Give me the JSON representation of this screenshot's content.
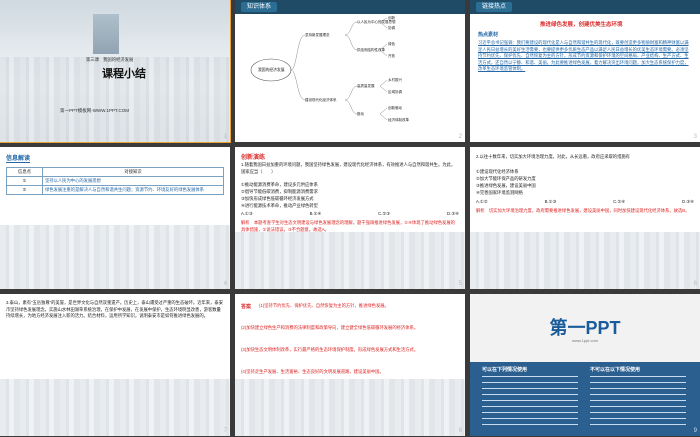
{
  "s1": {
    "section": "第三课　我国的经济发展",
    "title": "课程小结",
    "footer": "第一PPT模板网-WWW.1PPT.COM",
    "num": "1"
  },
  "s2": {
    "tag": "知识体系",
    "root": "我国的经济发展",
    "nodes": [
      "坚持新发展理念",
      "以人民为中心的发展思想",
      "创新",
      "协调",
      "绿色",
      "开放",
      "共享",
      "建设现代化经济体系",
      "供给侧结构性改革",
      "高质量发展",
      "推动",
      "坚持",
      "乡村振兴",
      "区域协调",
      "创新驱动",
      "经济体制改革",
      "对外开放"
    ],
    "num": "2"
  },
  "s3": {
    "tag": "链接热点",
    "headline": "推进绿色发展，创建优美生态环境",
    "sub": "热点素材",
    "body": "习近平总书记强调：我们要建设的现代化是人与自然和谐共生的现代化，既要创造更多物质财富和精神财富以满足人民日益增长的美好生活需要，也要提供更多优质生态产品以满足人民日益增长的优美生态环境需要。必须坚持节约优先、保护优先、自然恢复为主的方针，形成节约资源和保护环境的空间格局、产业结构、生产方式、生活方式，还自然以宁静、和谐、美丽。为此要推进绿色发展，着力解决突出环境问题，加大生态系统保护力度，改革生态环境监管体制。",
    "num": "3"
  },
  "s4": {
    "tag": "信息解读",
    "headers": [
      "信息点",
      "对接知识"
    ],
    "rows": [
      [
        "①",
        "坚持以人民为中心的发展思想"
      ],
      [
        "②",
        "绿色发展注重的是解决人与自然和谐共生问题；资源节约、环境友好的绿色发展体系"
      ]
    ],
    "num": "4"
  },
  "s5": {
    "title": "创新演练",
    "q": "1.随着我国日益加重的环境问题，我国坚持绿色发展，建设现代化经济体系，有效推进人与自然和谐共生。为此，国家应当（　　）",
    "opts": [
      "①推动能源消费革命，建设多元供应体系",
      "②倡导节能低碳消费，抑制能源消费需求",
      "③加快形成绿色低碳循环经济发展方式",
      "④进行能源技术革命，推动产业绿色转型"
    ],
    "choices": [
      "A.①③",
      "B.①④",
      "C.②③",
      "D.③④"
    ],
    "explain": "解析　本题考查学生对生态文明建设与绿色发展理念的理解。题干强调推进绿色发展，①④体现了推动绿色发展的具体措施，②说法错误，③不合题意。故选A。",
    "num": "5"
  },
  "s6": {
    "q": "2.以往十数年来，切实加大环境治理力度。对此，从长远看，政府应采取的措施有",
    "opts": [
      "①建设现代化经济体系",
      "②加大节能环保产品的研发力度",
      "③推进绿色发展，建设美丽中国",
      "④完善国家环境监测网络"
    ],
    "choices": [
      "A.①②",
      "B.①③",
      "C.②④",
      "D.③④"
    ],
    "explain": "解析　切实加大环境治理力度，政府需要推进绿色发展，建设美丽中国，同时加快建设现代化经济体系。故选B。",
    "num": "6"
  },
  "s7": {
    "body": "3.泰山，素有“五岳独尊”的美誉，是世界文化与自然双重遗产。历史上，泰山遭受过严重的生态破坏。近年来，泰安市坚持绿色发展理念，实施山水林田湖草系统治理，在保护中发展，在发展中保护，生态环境明显改善，游客数量持续增长，为地方经济发展注入新的活力。结合材料，运用所学知识，说明泰安市是如何推进绿色发展的。",
    "num": "7"
  },
  "s8": {
    "label": "答案",
    "lines": [
      "(1)坚持节约优先、保护优先、自然恢复为主的方针，推进绿色发展。",
      "(2)加快建立绿色生产和消费的法律制度和政策导向，建立健全绿色低碳循环发展的经济体系。",
      "(3)加快生态文明体制改革，实行最严格的生态环境保护制度，形成绿色发展方式和生活方式。",
      "(4)坚持走生产发展、生活富裕、生态良好的文明发展道路，建设美丽中国。"
    ],
    "num": "8"
  },
  "s9": {
    "logo": "第一PPT",
    "small": "www.1ppt.com",
    "left_title": "可以在下列情况使用",
    "right_title": "不可以在以下情况使用",
    "num": "9"
  }
}
